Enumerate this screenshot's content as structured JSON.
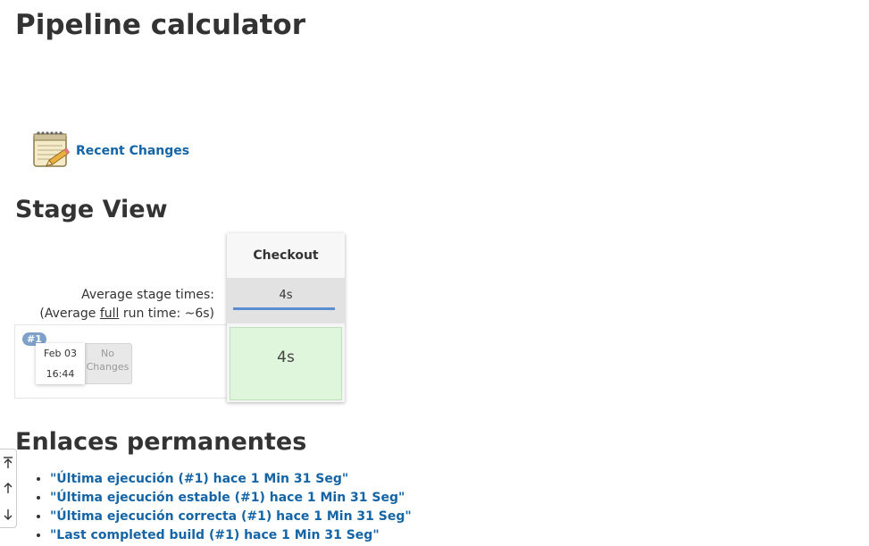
{
  "page": {
    "title": "Pipeline calculator"
  },
  "recent_changes": {
    "icon": "notepad-icon",
    "label": "Recent Changes"
  },
  "stage_view": {
    "title": "Stage View",
    "average_label": "Average stage times:",
    "full_run_prefix": "(Average ",
    "full_run_word": "full",
    "full_run_suffix": " run time: ~6s)",
    "stages": [
      {
        "name": "Checkout",
        "avg_time": "4s",
        "avg_progress": 1.0
      }
    ],
    "runs": [
      {
        "badge": "#1",
        "date": "Feb 03",
        "time": "16:44",
        "changes_line1": "No",
        "changes_line2": "Changes",
        "stage_times": [
          "4s"
        ],
        "status_color": "#dff6dd"
      }
    ]
  },
  "permalinks": {
    "title": "Enlaces permanentes",
    "items": [
      "\"Última ejecución (#1) hace 1 Min 31 Seg\"",
      "\"Última ejecución estable (#1) hace 1 Min 31 Seg\"",
      "\"Última ejecución correcta (#1) hace 1 Min 31 Seg\"",
      "\"Last completed build (#1) hace 1 Min 31 Seg\""
    ]
  },
  "scroll_widget": {
    "buttons": [
      "scroll-to-top-icon",
      "scroll-up-icon",
      "scroll-down-icon"
    ]
  },
  "colors": {
    "link": "#1565a6",
    "success": "#dff6dd",
    "progress": "#5b8ed1",
    "badge": "#7ea1c9"
  }
}
